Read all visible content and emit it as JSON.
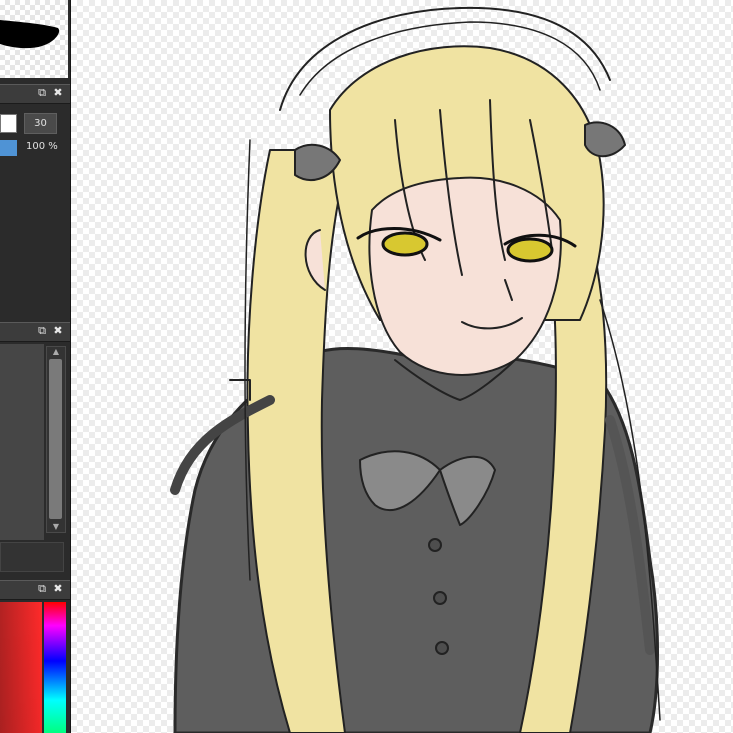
{
  "sidebar": {
    "brush_size_value": "30",
    "opacity_value": "100 %",
    "icons": [
      "popout-icon",
      "close-icon"
    ]
  },
  "colors": {
    "panel_bg": "#2b2b2b",
    "opacity_accent": "#4f93d5",
    "hair": "#f0e3a2",
    "skin": "#f7e1d8",
    "clothing": "#5a5a5a",
    "eyes": "#d8c830"
  }
}
